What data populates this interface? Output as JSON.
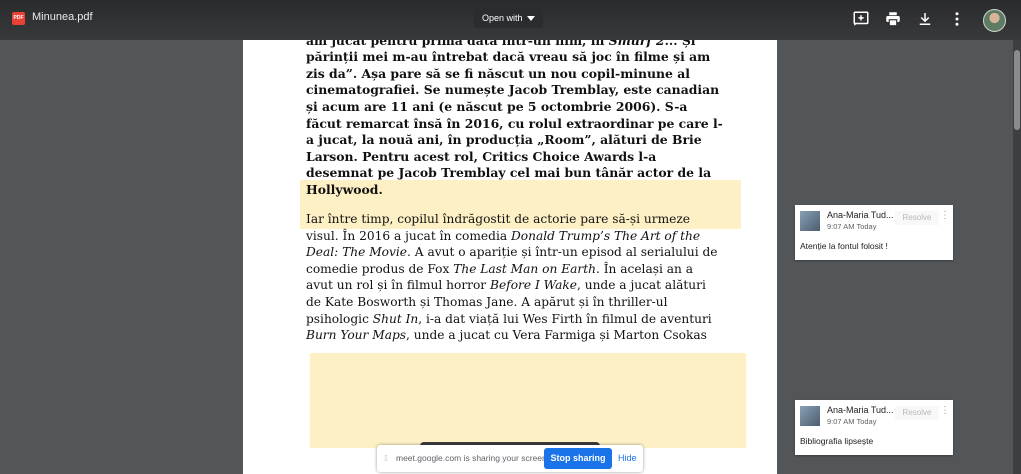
{
  "toolbar": {
    "file_icon_label": "PDF",
    "title": "Minunea.pdf",
    "open_with": "Open with",
    "icons": [
      "add-comment-icon",
      "print-icon",
      "download-icon",
      "more-vert-icon",
      "account-avatar"
    ]
  },
  "document": {
    "para1_html": "„Mi-am dorit să joc în filme de când aveam cinci ani. Atunci am jucat pentru prima dată într-un film, în <i>Smurf 2</i>... Și părinții mei m-au întrebat dacă vreau să joc în filme și am zis da”. Așa pare să se fi născut un nou copil-minune al cinematografiei. Se numește Jacob Tremblay, este canadian și acum are 11 ani (e născut pe 5 octombrie 2006). S-a făcut remarcat însă în 2016, cu rolul extraordinar pe care l-a jucat, la nouă ani, în producția „Room”, alături de Brie Larson. Pentru acest rol, Critics Choice Awards l-a desemnat pe Jacob Tremblay cel mai bun tânăr actor de la Hollywood.",
    "para2_html": "Iar între timp, copilul îndrăgostit de actorie pare să-și urmeze visul. În 2016 a jucat în comedia <i>Donald Trump’s The Art of the Deal: The Movie</i>. A avut o apariție și într-un episod al serialului de comedie produs de Fox <i>The Last Man on Earth</i>. În același an a avut un rol și în filmul horror <i>Before I Wake</i>, unde a jucat alături de Kate Bosworth și Thomas Jane. A apărut și în thriller-ul psihologic <i>Shut In</i>, i-a dat viață lui Wes Firth în filmul de aventuri <i>Burn Your Maps</i>, unde a jucat cu Vera Farmiga și Marton Csokas"
  },
  "comments": [
    {
      "author": "Ana-Maria Tud...",
      "time": "9:07 AM Today",
      "resolve": "Resolve",
      "text": "Atenție la fontul folosit !"
    },
    {
      "author": "Ana-Maria Tud...",
      "time": "9:07 AM Today",
      "resolve": "Resolve",
      "text": "Bibliografia lipsește"
    }
  ],
  "share_bar": {
    "message": "meet.google.com is sharing your screen.",
    "stop": "Stop sharing",
    "hide": "Hide"
  },
  "colors": {
    "highlight": "#fdf0c5",
    "accent": "#1a73e8",
    "background": "#525659"
  }
}
